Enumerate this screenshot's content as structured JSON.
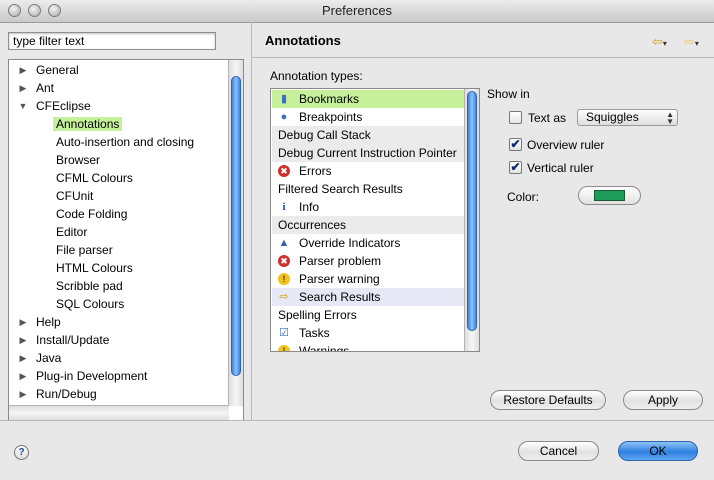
{
  "window": {
    "title": "Preferences"
  },
  "filter": {
    "value": "type filter text"
  },
  "tree": [
    {
      "label": "General",
      "expander": "collapsed",
      "level": 0
    },
    {
      "label": "Ant",
      "expander": "collapsed",
      "level": 0
    },
    {
      "label": "CFEclipse",
      "expander": "expanded",
      "level": 0
    },
    {
      "label": "Annotations",
      "expander": "none",
      "level": 1,
      "selected": true
    },
    {
      "label": "Auto-insertion and closing",
      "expander": "none",
      "level": 1
    },
    {
      "label": "Browser",
      "expander": "none",
      "level": 1
    },
    {
      "label": "CFML Colours",
      "expander": "none",
      "level": 1
    },
    {
      "label": "CFUnit",
      "expander": "none",
      "level": 1
    },
    {
      "label": "Code Folding",
      "expander": "none",
      "level": 1
    },
    {
      "label": "Editor",
      "expander": "none",
      "level": 1
    },
    {
      "label": "File parser",
      "expander": "none",
      "level": 1
    },
    {
      "label": "HTML Colours",
      "expander": "none",
      "level": 1
    },
    {
      "label": "Scribble pad",
      "expander": "none",
      "level": 1
    },
    {
      "label": "SQL Colours",
      "expander": "none",
      "level": 1
    },
    {
      "label": "Help",
      "expander": "collapsed",
      "level": 0
    },
    {
      "label": "Install/Update",
      "expander": "collapsed",
      "level": 0
    },
    {
      "label": "Java",
      "expander": "collapsed",
      "level": 0
    },
    {
      "label": "Plug-in Development",
      "expander": "collapsed",
      "level": 0
    },
    {
      "label": "Run/Debug",
      "expander": "collapsed",
      "level": 0
    }
  ],
  "page": {
    "title": "Annotations",
    "nav": {
      "back_icon": "back-arrow-icon",
      "forward_icon": "forward-arrow-icon"
    },
    "types_label": "Annotation types:",
    "annotation_types": [
      {
        "label": "Bookmarks",
        "icon": "bookmark-icon",
        "kind": "item",
        "selected": true
      },
      {
        "label": "Breakpoints",
        "icon": "breakpoint-icon",
        "kind": "item"
      },
      {
        "label": "Debug Call Stack",
        "icon": "",
        "kind": "category"
      },
      {
        "label": "Debug Current Instruction Pointer",
        "icon": "",
        "kind": "category"
      },
      {
        "label": "Errors",
        "icon": "error-icon",
        "kind": "item"
      },
      {
        "label": "Filtered Search Results",
        "icon": "",
        "kind": "plain"
      },
      {
        "label": "Info",
        "icon": "info-icon",
        "kind": "item"
      },
      {
        "label": "Occurrences",
        "icon": "",
        "kind": "category"
      },
      {
        "label": "Override Indicators",
        "icon": "override-icon",
        "kind": "item"
      },
      {
        "label": "Parser problem",
        "icon": "error-icon",
        "kind": "item"
      },
      {
        "label": "Parser warning",
        "icon": "warning-icon",
        "kind": "item"
      },
      {
        "label": "Search Results",
        "icon": "search-result-icon",
        "kind": "item",
        "hover": true
      },
      {
        "label": "Spelling Errors",
        "icon": "",
        "kind": "plain"
      },
      {
        "label": "Tasks",
        "icon": "task-icon",
        "kind": "item"
      },
      {
        "label": "Warnings",
        "icon": "warning-icon",
        "kind": "item"
      }
    ],
    "show_in_label": "Show in",
    "text_as": {
      "label": "Text as",
      "checked": false,
      "style_value": "Squiggles"
    },
    "overview_ruler": {
      "label": "Overview ruler",
      "checked": true
    },
    "vertical_ruler": {
      "label": "Vertical ruler",
      "checked": true
    },
    "color_label": "Color:",
    "color_value": "#1e9d5a",
    "restore_defaults_label": "Restore Defaults",
    "apply_label": "Apply"
  },
  "footer": {
    "cancel_label": "Cancel",
    "ok_label": "OK"
  }
}
